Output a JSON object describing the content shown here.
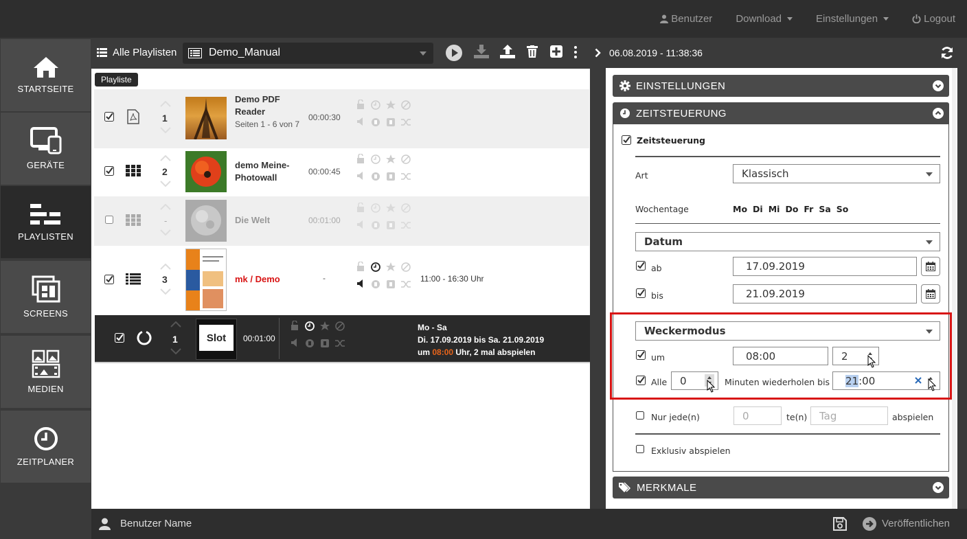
{
  "topnav": {
    "user": "Benutzer",
    "download": "Download",
    "settings": "Einstellungen",
    "logout": "Logout"
  },
  "sidebar": {
    "items": [
      {
        "label": "STARTSEITE",
        "icon": "home-icon"
      },
      {
        "label": "GERÄTE",
        "icon": "devices-icon"
      },
      {
        "label": "PLAYLISTEN",
        "icon": "playlist-icon"
      },
      {
        "label": "SCREENS",
        "icon": "screens-icon"
      },
      {
        "label": "MEDIEN",
        "icon": "media-icon"
      },
      {
        "label": "ZEITPLANER",
        "icon": "clock-icon"
      }
    ]
  },
  "playlist_header": {
    "all_label": "Alle Playlisten",
    "selected": "Demo_Manual"
  },
  "tooltip": "Playliste",
  "rows": [
    {
      "num": "1",
      "title": "Demo PDF Reader",
      "sub": "Seiten 1 - 6 von 7",
      "duration": "00:00:30",
      "type": "pdf-icon"
    },
    {
      "num": "2",
      "title": "demo Meine-Photowall",
      "duration": "00:00:45",
      "type": "grid-icon"
    },
    {
      "num": "-",
      "title": "Die Welt",
      "duration": "00:01:00",
      "type": "grid-icon"
    },
    {
      "num": "3",
      "title": "mk / Demo",
      "duration": "-",
      "schedule": "11:00 - 16:30 Uhr",
      "type": "list-icon"
    },
    {
      "num": "1",
      "slot_label": "Slot",
      "duration": "00:01:00",
      "sched1": "Mo - Sa",
      "sched2": "Di. 17.09.2019 bis Sa. 21.09.2019",
      "sched3a": "um ",
      "sched3b": "08:00",
      "sched3c": " Uhr, 2 mal abspielen"
    }
  ],
  "right_panel": {
    "datetime": "06.08.2019 - 11:38:36",
    "einstellungen": "EINSTELLUNGEN",
    "zeitsteuerung": "ZEITSTEUERUNG",
    "zeitsteuerung_chk": "Zeitsteuerung",
    "art_label": "Art",
    "art_value": "Klassisch",
    "wochentage_label": "Wochentage",
    "wochentage": [
      "Mo",
      "Di",
      "Mi",
      "Do",
      "Fr",
      "Sa",
      "So"
    ],
    "datum_select": "Datum",
    "ab_label": "ab",
    "ab_value": "17.09.2019",
    "bis_label": "bis",
    "bis_value": "21.09.2019",
    "wecker_select": "Weckermodus",
    "um_label": "um",
    "um_value": "08:00",
    "times_value": "2",
    "alle_label": "Alle",
    "alle_value": "0",
    "repeat_label": "Minuten wiederholen bis",
    "until_hl": "21",
    "until_rest": ":00",
    "nur_label": "Nur jede(n)",
    "nur_value": "0",
    "nur_unit": "te(n)",
    "tag_placeholder": "Tag",
    "abspielen": "abspielen",
    "exklusiv": "Exklusiv abspielen",
    "merkmale": "MERKMALE"
  },
  "footer": {
    "user": "Benutzer Name",
    "publish": "Veröffentlichen"
  },
  "colors": {
    "accent_red": "#d81414",
    "orange": "#e8641a",
    "dark": "#2e2e2e"
  }
}
